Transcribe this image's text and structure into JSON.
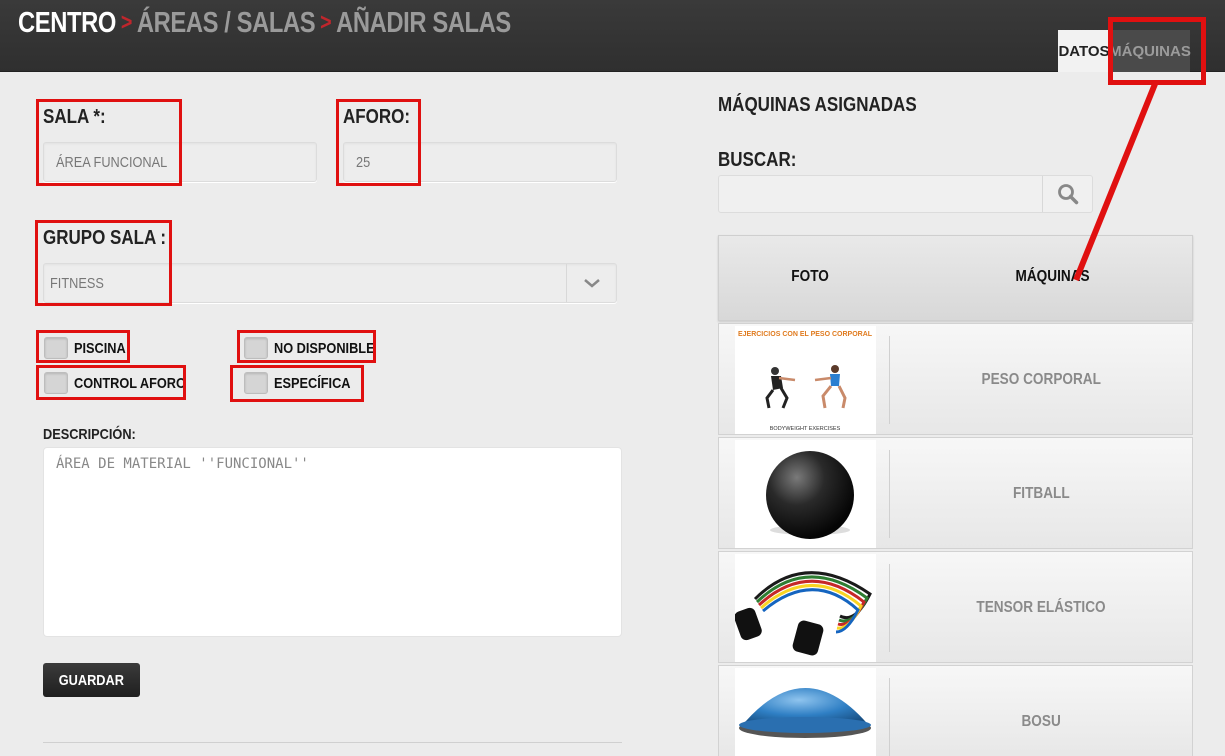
{
  "breadcrumb": {
    "home": "CENTRO",
    "separator": ">",
    "items": [
      "ÁREAS / SALAS",
      "AÑADIR SALAS"
    ]
  },
  "tabs": [
    {
      "label": "DATOS"
    },
    {
      "label": "MÁQUINAS"
    }
  ],
  "form": {
    "sala_label": "SALA *:",
    "sala_value": "ÁREA FUNCIONAL",
    "aforo_label": "AFORO:",
    "aforo_value": "25",
    "grupo_label": "GRUPO SALA :",
    "grupo_value": "FITNESS",
    "checkboxes": {
      "piscina": "PISCINA",
      "no_disponible": "NO DISPONIBLE",
      "control_aforo": "CONTROL AFORO",
      "especifica": "ESPECÍFICA"
    },
    "descripcion_label": "DESCRIPCIÓN:",
    "descripcion_value": "ÁREA DE MATERIAL ''FUNCIONAL''",
    "guardar_label": "GUARDAR"
  },
  "machines_panel": {
    "title": "MÁQUINAS ASIGNADAS",
    "search_label": "BUSCAR:",
    "search_icon": "search-icon",
    "columns": [
      "FOTO",
      "MÁQUINAS"
    ],
    "rows": [
      {
        "name": "PESO CORPORAL",
        "thumb_caption_top": "EJERCICIOS CON EL PESO CORPORAL",
        "thumb_caption_bottom": "BODYWEIGHT EXERCISES"
      },
      {
        "name": "FITBALL"
      },
      {
        "name": "TENSOR ELÁSTICO"
      },
      {
        "name": "BOSU"
      }
    ]
  },
  "colors": {
    "header_bg": "#333333",
    "accent_red": "#c0262c",
    "highlight_red": "#e01010"
  }
}
